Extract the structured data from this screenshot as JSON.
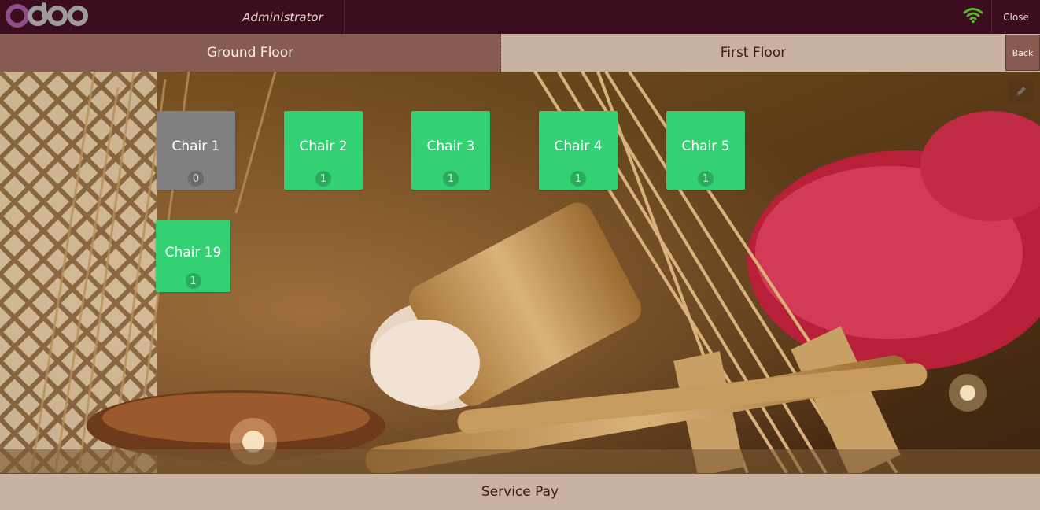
{
  "header": {
    "logo_text": "odoo",
    "user": "Administrator",
    "close_label": "Close",
    "connection_icon": "wifi-icon"
  },
  "floors": {
    "tabs": [
      {
        "label": "Ground Floor",
        "active": true
      },
      {
        "label": "First Floor",
        "active": false
      }
    ],
    "back_label": "Back"
  },
  "floor_plan": {
    "edit_icon": "pencil-icon",
    "tables": [
      {
        "name": "Chair 1",
        "count": "0",
        "color": "#808080"
      },
      {
        "name": "Chair 2",
        "count": "1",
        "color": "#33d173"
      },
      {
        "name": "Chair 3",
        "count": "1",
        "color": "#33d173"
      },
      {
        "name": "Chair 4",
        "count": "1",
        "color": "#33d173"
      },
      {
        "name": "Chair 5",
        "count": "1",
        "color": "#33d173"
      },
      {
        "name": "Chair 19",
        "count": "1",
        "color": "#33d173"
      }
    ]
  },
  "footer": {
    "label": "Service Pay"
  },
  "colors": {
    "topbar": "#3b0d1d",
    "active_floor": "#875a52",
    "inactive_floor": "#c9b29f",
    "table_free": "#808080",
    "table_occupied": "#33d173",
    "logo_purple": "#8f4d8c",
    "logo_grey": "#9c9c9c",
    "wifi_green": "#5ab52c"
  }
}
